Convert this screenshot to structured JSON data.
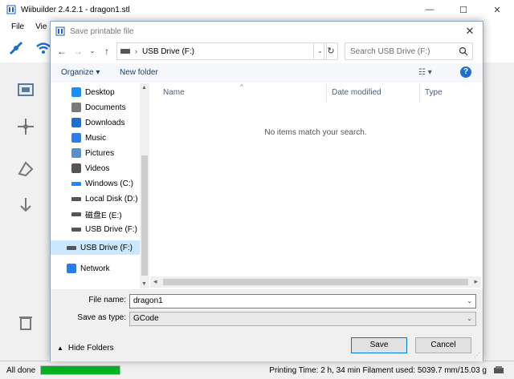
{
  "app": {
    "title": "Wiibuilder 2.4.2.1 - dragon1.stl",
    "menu": [
      "File",
      "Vie"
    ],
    "status_left": "All done",
    "status_progress": 1.0,
    "status_right": "Printing Time:  2 h, 34 min    Filament used:  5039.7 mm/15.03 g"
  },
  "dialog": {
    "title": "Save printable file",
    "address_path": "USB Drive (F:)",
    "search_placeholder": "Search USB Drive (F:)",
    "organize_label": "Organize ▾",
    "new_folder_label": "New folder",
    "help_label": "?",
    "nav_items": [
      {
        "label": "Desktop",
        "icon": "desktop-icon",
        "color": "#1a8cff"
      },
      {
        "label": "Documents",
        "icon": "documents-icon",
        "color": "#7a7a7a"
      },
      {
        "label": "Downloads",
        "icon": "downloads-icon",
        "color": "#1f6fd0"
      },
      {
        "label": "Music",
        "icon": "music-icon",
        "color": "#2b7de9"
      },
      {
        "label": "Pictures",
        "icon": "pictures-icon",
        "color": "#5b8fc7"
      },
      {
        "label": "Videos",
        "icon": "videos-icon",
        "color": "#555555"
      },
      {
        "label": "Windows (C:)",
        "icon": "windows-drive-icon",
        "color": "#1a8cff"
      },
      {
        "label": "Local Disk (D:)",
        "icon": "local-disk-icon",
        "color": "#555555"
      },
      {
        "label": "磁盘E (E:)",
        "icon": "disk-icon",
        "color": "#555555"
      },
      {
        "label": "USB Drive (F:)",
        "icon": "usb-drive-icon",
        "color": "#555555"
      },
      {
        "label": "USB Drive (F:)",
        "icon": "usb-drive-icon",
        "color": "#555555",
        "selected": true
      },
      {
        "label": "Network",
        "icon": "network-icon",
        "color": "#2b7de9"
      }
    ],
    "columns": [
      "Name",
      "Date modified",
      "Type"
    ],
    "empty_message": "No items match your search.",
    "file_name_label": "File name:",
    "file_name_value": "dragon1",
    "save_as_type_label": "Save as type:",
    "save_as_type_value": "GCode",
    "hide_folders_label": "Hide Folders",
    "save_label": "Save",
    "cancel_label": "Cancel"
  },
  "colors": {
    "accent": "#0078d7",
    "progress": "#06b025",
    "selection": "#cce8ff"
  }
}
